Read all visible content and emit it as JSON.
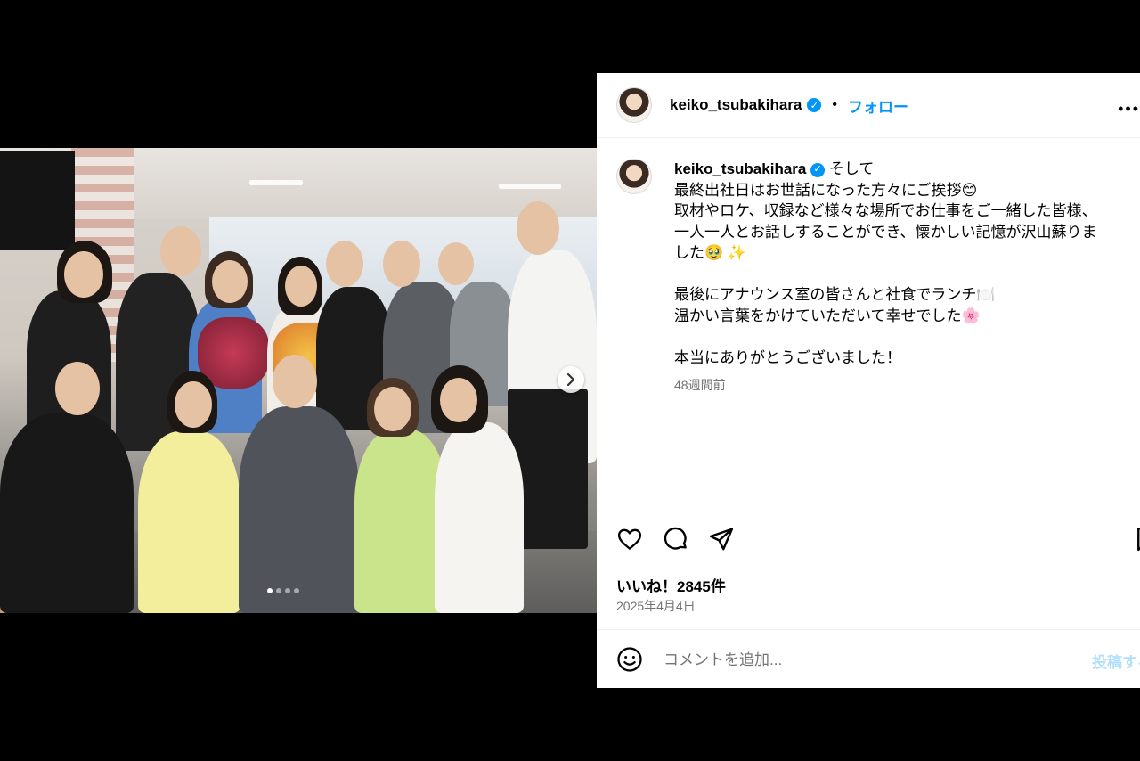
{
  "post": {
    "username": "keiko_tsubakihara",
    "verified_mark": "✓",
    "follow_label": "フォロー",
    "more_label": "•••",
    "caption_first_line": "そして",
    "caption_lines": [
      "最終出社日はお世話になった方々にご挨拶😊",
      "取材やロケ、収録など様々な場所でお仕事をご一緒した皆様、",
      "一人一人とお話しすることができ、懐かしい記憶が沢山蘇りま",
      "した🥹 ✨",
      "",
      "最後にアナウンス室の皆さんと社食でランチ🍽️",
      "温かい言葉をかけていただいて幸せでした🌸",
      "",
      "本当にありがとうございました！"
    ],
    "time_ago": "48週間前",
    "likes": "いいね！2845件",
    "date": "2025年4月4日"
  },
  "comment": {
    "placeholder": "コメントを追加...",
    "post_label": "投稿する"
  },
  "carousel": {
    "slide_count": 4,
    "active_index": 0
  },
  "colors": {
    "accent": "#0095f6",
    "post_disabled": "#b2dffc",
    "muted": "#737373"
  },
  "icons": [
    "heart-icon",
    "comment-icon",
    "share-icon",
    "bookmark-icon",
    "emoji-icon",
    "chevron-right-icon",
    "verified-icon"
  ]
}
